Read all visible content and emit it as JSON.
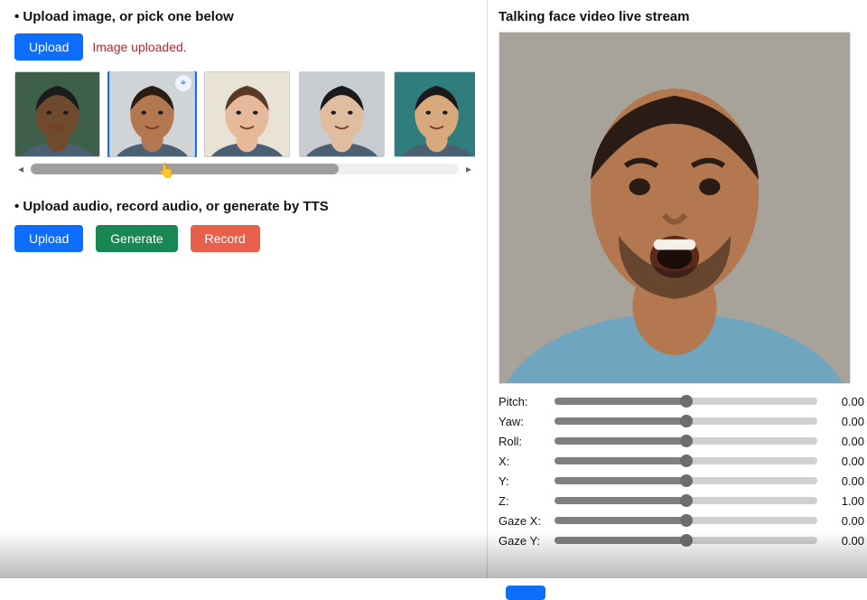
{
  "left": {
    "image_section_title": "Upload image, or pick one below",
    "upload_button": "Upload",
    "upload_status": "Image uploaded.",
    "thumbnails": [
      {
        "id": "face-1",
        "selected": false,
        "bg": "#3e5f4a",
        "skin": "#6f4a2e",
        "hair": "#1c1c1c"
      },
      {
        "id": "face-2",
        "selected": true,
        "bg": "#d0d4d7",
        "skin": "#b37850",
        "hair": "#2a1c14"
      },
      {
        "id": "face-3",
        "selected": false,
        "bg": "#e9e3d7",
        "skin": "#e6b99b",
        "hair": "#5a3a24"
      },
      {
        "id": "face-4",
        "selected": false,
        "bg": "#c8ccd1",
        "skin": "#e1bda0",
        "hair": "#1a1a1a"
      },
      {
        "id": "face-5",
        "selected": false,
        "bg": "#2f7d7d",
        "skin": "#d9a97e",
        "hair": "#1a1a1a"
      }
    ],
    "select_icon_name": "target-icon",
    "audio_section_title": "Upload audio, record audio, or generate by TTS",
    "audio_buttons": {
      "upload": "Upload",
      "generate": "Generate",
      "record": "Record"
    }
  },
  "right": {
    "title": "Talking face video live stream",
    "sliders": [
      {
        "label": "Pitch:",
        "value": "0.00",
        "pos": 0.5
      },
      {
        "label": "Yaw:",
        "value": "0.00",
        "pos": 0.5
      },
      {
        "label": "Roll:",
        "value": "0.00",
        "pos": 0.5
      },
      {
        "label": "X:",
        "value": "0.00",
        "pos": 0.5
      },
      {
        "label": "Y:",
        "value": "0.00",
        "pos": 0.5
      },
      {
        "label": "Z:",
        "value": "1.00",
        "pos": 0.5
      },
      {
        "label": "Gaze X:",
        "value": "0.00",
        "pos": 0.5
      },
      {
        "label": "Gaze Y:",
        "value": "0.00",
        "pos": 0.5
      }
    ]
  },
  "colors": {
    "primary": "#0d6efd",
    "success": "#198754",
    "danger": "#e8604c",
    "status_text": "#b02a37"
  }
}
